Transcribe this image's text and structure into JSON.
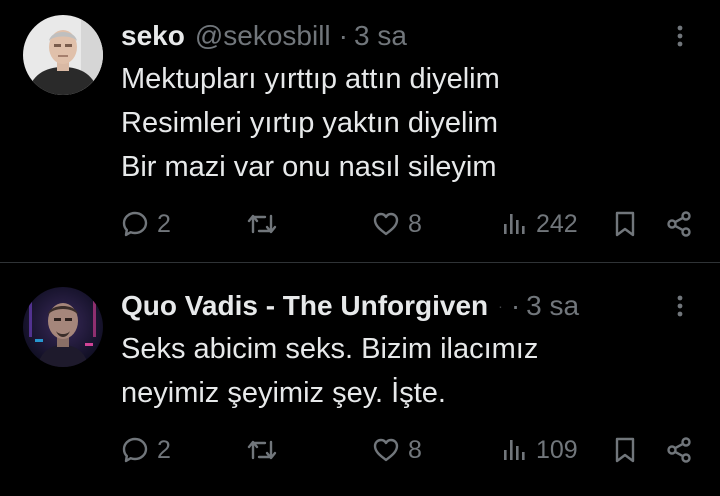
{
  "tweets": [
    {
      "display_name": "seko",
      "handle": "@sekosbill",
      "separator": "·",
      "time": "3 sa",
      "lines": [
        "Mektupları yırttıp attın diyelim",
        "Resimleri yırtıp yaktın diyelim",
        "Bir mazi var onu nasıl sileyim"
      ],
      "replies": "2",
      "likes": "8",
      "views": "242"
    },
    {
      "display_name": "Quo Vadis - The Unforgiven",
      "faint": "·",
      "separator": "·",
      "time": "3 sa",
      "lines": [
        "Seks abicim seks. Bizim ilacımız",
        "neyimiz şeyimiz şey. İşte."
      ],
      "replies": "2",
      "likes": "8",
      "views": "109"
    }
  ],
  "icons": {
    "more": "more-vertical-icon",
    "reply": "reply-icon",
    "retweet": "retweet-icon",
    "like": "heart-icon",
    "views": "views-icon",
    "bookmark": "bookmark-icon",
    "share": "share-icon"
  },
  "colors": {
    "background": "#000000",
    "text": "#e7e9ea",
    "muted": "#71767b",
    "divider": "#2f3336"
  }
}
